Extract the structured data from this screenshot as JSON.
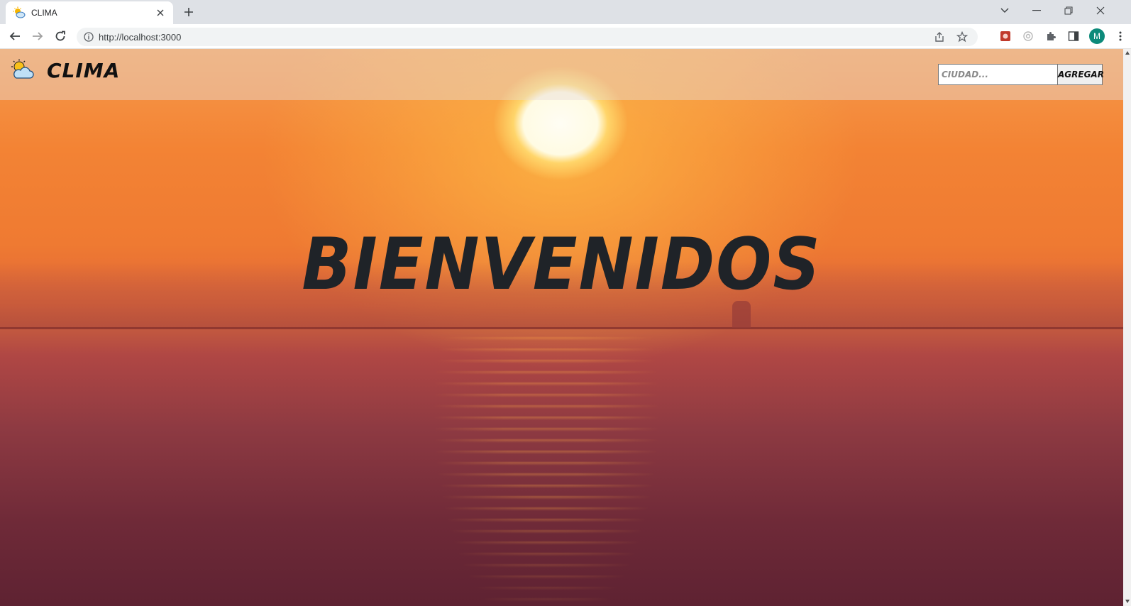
{
  "browser": {
    "tab_title": "CLIMA",
    "url": "http://localhost:3000",
    "avatar_letter": "M"
  },
  "app": {
    "brand": "CLIMA",
    "search": {
      "placeholder": "CIUDAD...",
      "value": ""
    },
    "add_button_label": "AGREGAR",
    "welcome_text": "BIENVENIDOS"
  }
}
